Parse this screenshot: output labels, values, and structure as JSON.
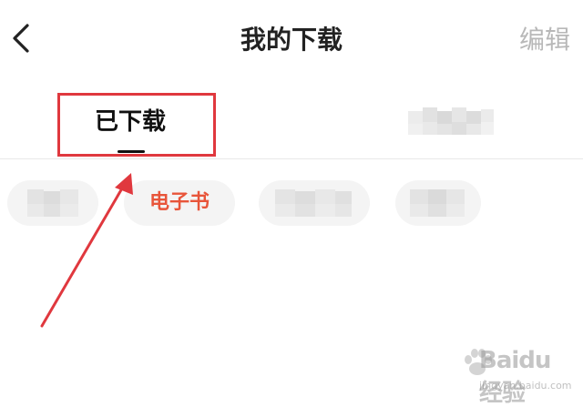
{
  "header": {
    "back_icon": "chevron-left-icon",
    "title": "我的下载",
    "edit_label": "编辑"
  },
  "tabs": [
    {
      "label": "已下载",
      "active": true
    },
    {
      "label": "",
      "active": false,
      "obscured": true
    }
  ],
  "filters": [
    {
      "label": "",
      "obscured": true
    },
    {
      "label": "电子书",
      "active": true
    },
    {
      "label": "",
      "obscured": true
    },
    {
      "label": "",
      "obscured": true
    }
  ],
  "colors": {
    "accent": "#e8553a",
    "annotation": "#e0383e",
    "title": "#222222",
    "edit": "#b8b8b8"
  },
  "watermark": {
    "brand": "Baidu经验",
    "url": "jingyan.baidu.com"
  }
}
